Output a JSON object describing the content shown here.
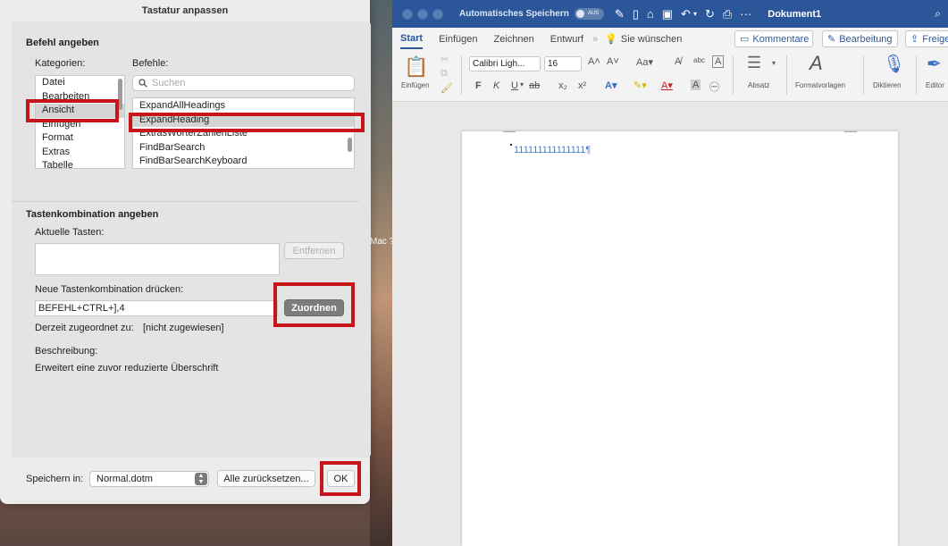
{
  "dialog": {
    "title": "Tastatur anpassen",
    "section_command": "Befehl angeben",
    "categories_label": "Kategorien:",
    "commands_label": "Befehle:",
    "search_placeholder": "Suchen",
    "categories": [
      "Datei",
      "Bearbeiten",
      "Ansicht",
      "Einfügen",
      "Format",
      "Extras",
      "Tabelle"
    ],
    "selected_category": "Ansicht",
    "commands": [
      "ExpandAllHeadings",
      "ExpandHeading",
      "ExtrasWörterZählenListe",
      "FindBarSearch",
      "FindBarSearchKeyboard"
    ],
    "selected_command": "ExpandHeading",
    "section_shortcut": "Tastenkombination angeben",
    "current_keys_label": "Aktuelle Tasten:",
    "remove_button": "Entfernen",
    "new_shortcut_label": "Neue Tastenkombination drücken:",
    "new_shortcut_value": "BEFEHL+CTRL+],4",
    "assign_button": "Zuordnen",
    "currently_assigned_label": "Derzeit zugeordnet zu:",
    "currently_assigned_value": "[nicht zugewiesen]",
    "description_label": "Beschreibung:",
    "description_value": "Erweitert eine zuvor reduzierte Überschrift",
    "save_in_label": "Speichern in:",
    "save_in_value": "Normal.dotm",
    "reset_all_button": "Alle zurücksetzen...",
    "ok_button": "OK"
  },
  "desktop": {
    "label": "Mac ?"
  },
  "word": {
    "autosave_label": "Automatisches Speichern",
    "autosave_state": "AUS",
    "doc_title": "Dokument1",
    "tabs": [
      "Start",
      "Einfügen",
      "Zeichnen",
      "Entwurf"
    ],
    "tell_me": "Sie wünschen",
    "comments_button": "Kommentare",
    "editing_button": "Bearbeitung",
    "share_button": "Freige",
    "ribbon": {
      "paste_label": "Einfügen",
      "font_name": "Calibri Ligh...",
      "font_size": "16",
      "paragraph_label": "Absatz",
      "styles_label": "Formatvorlagen",
      "dictate_label": "Diktieren",
      "editor_label": "Editor",
      "bold": "F",
      "italic": "K",
      "underline": "U"
    },
    "document_text": "111111111111111¶"
  }
}
